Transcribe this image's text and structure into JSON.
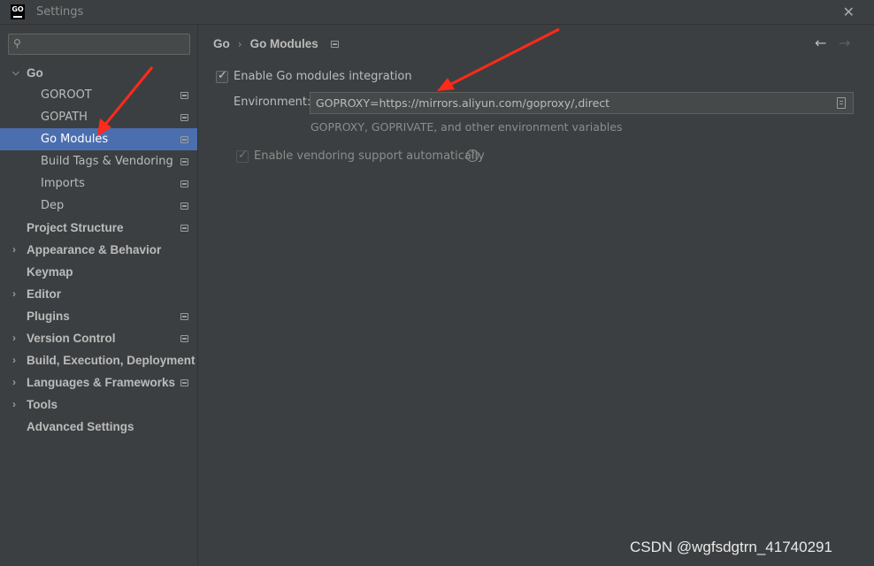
{
  "window": {
    "title": "Settings",
    "logo_text": "GO"
  },
  "search": {
    "icon": "search-icon",
    "placeholder": ""
  },
  "tree": [
    {
      "label": "Go",
      "bold": true,
      "arrow": "⌵",
      "indent": 30,
      "pin": false,
      "selected": false
    },
    {
      "label": "GOROOT",
      "bold": false,
      "arrow": "",
      "indent": 46,
      "pin": true,
      "selected": false
    },
    {
      "label": "GOPATH",
      "bold": false,
      "arrow": "",
      "indent": 46,
      "pin": true,
      "selected": false
    },
    {
      "label": "Go Modules",
      "bold": false,
      "arrow": "",
      "indent": 46,
      "pin": true,
      "selected": true
    },
    {
      "label": "Build Tags & Vendoring",
      "bold": false,
      "arrow": "",
      "indent": 46,
      "pin": true,
      "selected": false
    },
    {
      "label": "Imports",
      "bold": false,
      "arrow": "",
      "indent": 46,
      "pin": true,
      "selected": false
    },
    {
      "label": "Dep",
      "bold": false,
      "arrow": "",
      "indent": 46,
      "pin": true,
      "selected": false
    },
    {
      "label": "Project Structure",
      "bold": true,
      "arrow": "",
      "indent": 30,
      "pin": true,
      "selected": false
    },
    {
      "label": "Appearance & Behavior",
      "bold": true,
      "arrow": "›",
      "indent": 30,
      "pin": false,
      "selected": false
    },
    {
      "label": "Keymap",
      "bold": true,
      "arrow": "",
      "indent": 30,
      "pin": false,
      "selected": false
    },
    {
      "label": "Editor",
      "bold": true,
      "arrow": "›",
      "indent": 30,
      "pin": false,
      "selected": false
    },
    {
      "label": "Plugins",
      "bold": true,
      "arrow": "",
      "indent": 30,
      "pin": true,
      "selected": false
    },
    {
      "label": "Version Control",
      "bold": true,
      "arrow": "›",
      "indent": 30,
      "pin": true,
      "selected": false
    },
    {
      "label": "Build, Execution, Deployment",
      "bold": true,
      "arrow": "›",
      "indent": 30,
      "pin": false,
      "selected": false
    },
    {
      "label": "Languages & Frameworks",
      "bold": true,
      "arrow": "›",
      "indent": 30,
      "pin": true,
      "selected": false
    },
    {
      "label": "Tools",
      "bold": true,
      "arrow": "›",
      "indent": 30,
      "pin": false,
      "selected": false
    },
    {
      "label": "Advanced Settings",
      "bold": true,
      "arrow": "",
      "indent": 30,
      "pin": false,
      "selected": false
    }
  ],
  "breadcrumb": {
    "root": "Go",
    "separator": "›",
    "leaf": "Go Modules"
  },
  "nav": {
    "back": "←",
    "forward": "→"
  },
  "go_modules": {
    "enable_label": "Enable Go modules integration",
    "enable_checked": true,
    "environment_label": "Environment:",
    "environment_value": "GOPROXY=https://mirrors.aliyun.com/goproxy/,direct",
    "environment_hint": "GOPROXY, GOPRIVATE, and other environment variables",
    "vendoring_label": "Enable vendoring support automatically",
    "vendoring_checked": true,
    "vendoring_enabled": false,
    "help_glyph": "?"
  },
  "watermark": "CSDN @wgfsdgtrn_41740291",
  "colors": {
    "background": "#3c3f41",
    "selection": "#4b6eaf",
    "annotation_arrow": "#ff2a1a"
  }
}
